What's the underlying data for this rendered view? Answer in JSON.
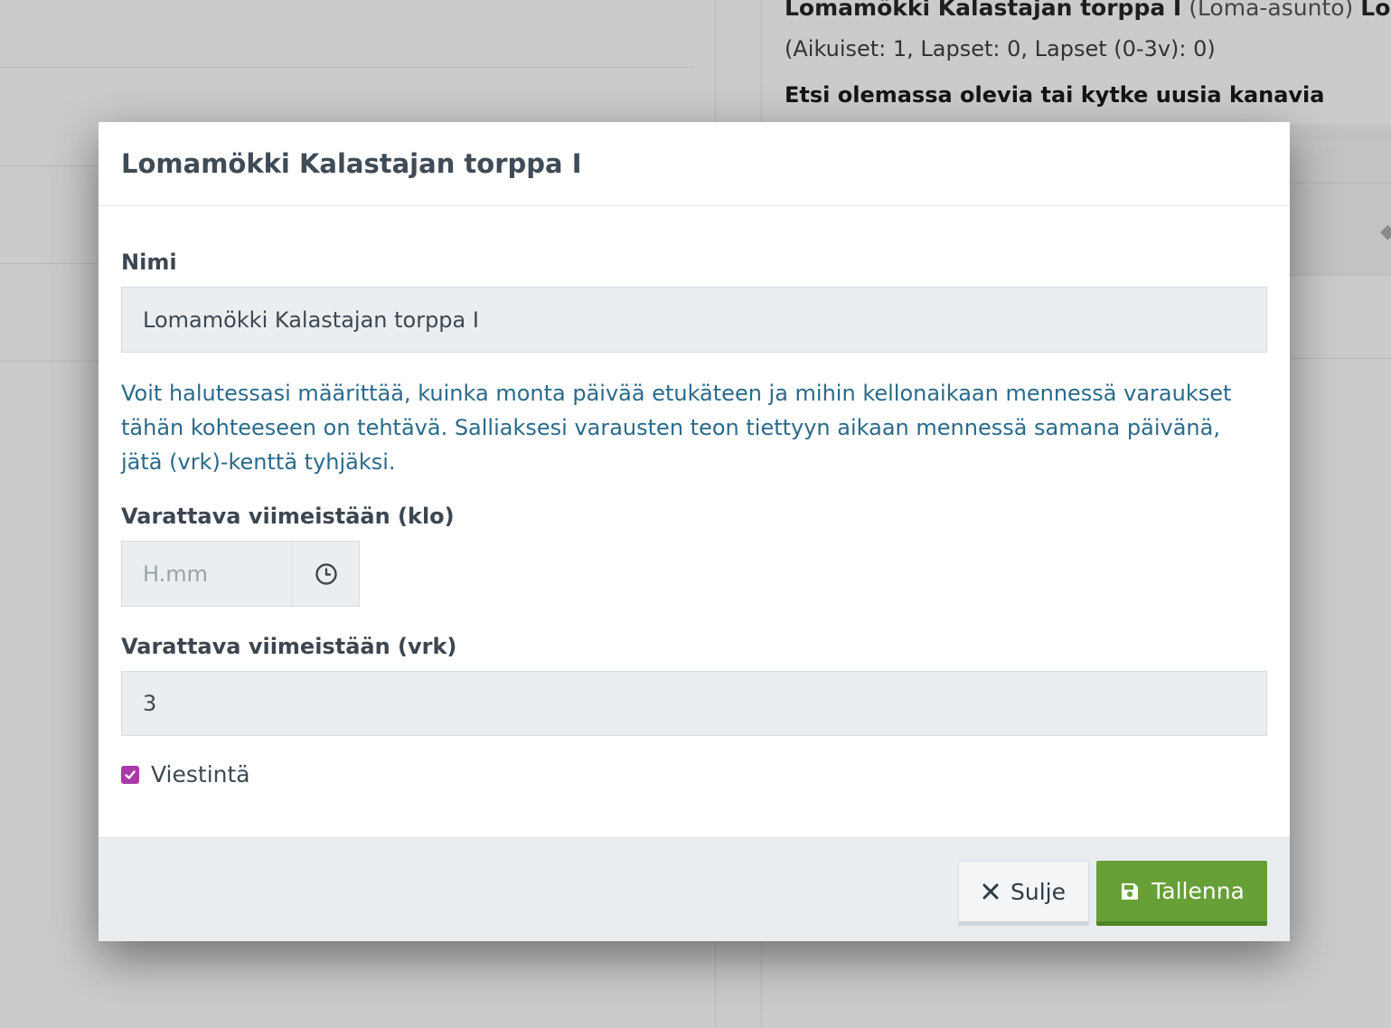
{
  "background": {
    "header_bold": "Lomamökki Kalastajan torppa I",
    "header_type": "(Loma-asunto)",
    "header_cut": "Lomam",
    "occupants": "(Aikuiset: 1, Lapset: 0, Lapset (0-3v): 0)",
    "channels": "Etsi olemassa olevia tai kytke uusia kanavia"
  },
  "modal": {
    "title": "Lomamökki Kalastajan torppa I",
    "name_label": "Nimi",
    "name_value": "Lomamökki Kalastajan torppa I",
    "help_text": "Voit halutessasi määrittää, kuinka monta päivää etukäteen ja mihin kellonaikaan mennessä varaukset tähän kohteeseen on tehtävä. Salliaksesi varausten teon tiettyyn aikaan mennessä samana päivänä, jätä (vrk)-kenttä tyhjäksi.",
    "time_label": "Varattava viimeistään (klo)",
    "time_placeholder": "H.mm",
    "days_label": "Varattava viimeistään (vrk)",
    "days_value": "3",
    "checkbox_label": "Viestintä",
    "checkbox_checked": true,
    "close_label": "Sulje",
    "save_label": "Tallenna"
  },
  "colors": {
    "accent_save": "#66a036",
    "checkbox": "#a83aa7",
    "help_text": "#2a6a8a"
  },
  "icons": {
    "time": "clock-icon",
    "close": "close-icon",
    "save": "save-icon"
  }
}
